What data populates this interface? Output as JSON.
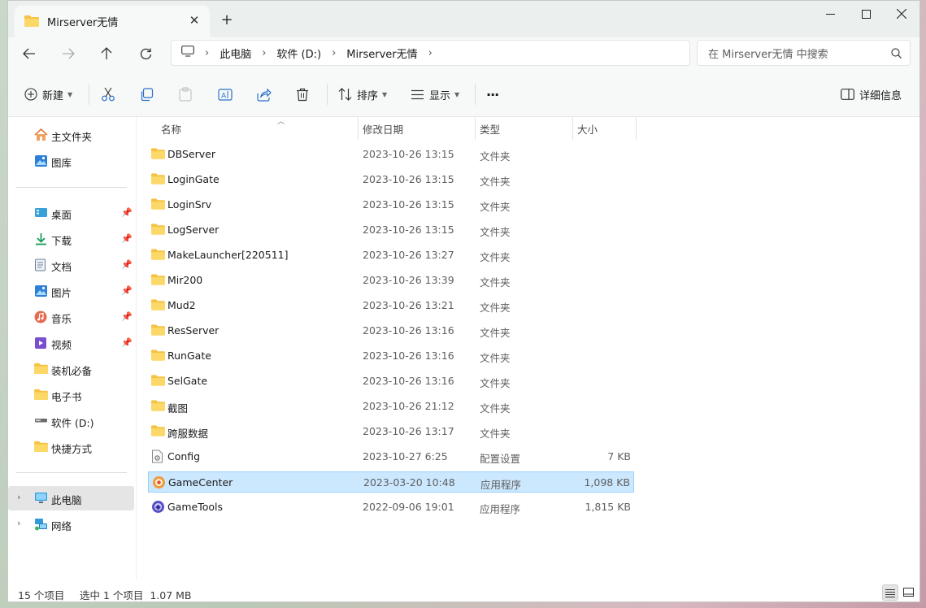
{
  "window": {
    "tab_title": "Mirserver无情",
    "new_tab_symbol": "+"
  },
  "address": {
    "crumbs": [
      "此电脑",
      "软件 (D:)",
      "Mirserver无情"
    ],
    "search_placeholder": "在 Mirserver无情 中搜索"
  },
  "toolbar": {
    "new_label": "新建",
    "sort_label": "排序",
    "view_label": "显示",
    "more_label": "···",
    "details_label": "详细信息"
  },
  "sidebar": {
    "top": [
      {
        "label": "主文件夹",
        "icon": "home-icon"
      },
      {
        "label": "图库",
        "icon": "gallery-icon"
      }
    ],
    "pinned": [
      {
        "label": "桌面",
        "icon": "desktop-icon"
      },
      {
        "label": "下载",
        "icon": "download-icon"
      },
      {
        "label": "文档",
        "icon": "documents-icon"
      },
      {
        "label": "图片",
        "icon": "pictures-icon"
      },
      {
        "label": "音乐",
        "icon": "music-icon"
      },
      {
        "label": "视频",
        "icon": "videos-icon"
      }
    ],
    "folders": [
      {
        "label": "装机必备",
        "icon": "folder-icon"
      },
      {
        "label": "电子书",
        "icon": "folder-icon"
      },
      {
        "label": "软件 (D:)",
        "icon": "drive-icon"
      },
      {
        "label": "快捷方式",
        "icon": "folder-icon"
      }
    ],
    "bottom": [
      {
        "label": "此电脑",
        "icon": "pc-icon"
      },
      {
        "label": "网络",
        "icon": "network-icon"
      }
    ]
  },
  "columns": {
    "name": "名称",
    "date": "修改日期",
    "type": "类型",
    "size": "大小"
  },
  "files": [
    {
      "name": "DBServer",
      "date": "2023-10-26 13:15",
      "type": "文件夹",
      "size": "",
      "icon": "folder-icon"
    },
    {
      "name": "LoginGate",
      "date": "2023-10-26 13:15",
      "type": "文件夹",
      "size": "",
      "icon": "folder-icon"
    },
    {
      "name": "LoginSrv",
      "date": "2023-10-26 13:15",
      "type": "文件夹",
      "size": "",
      "icon": "folder-icon"
    },
    {
      "name": "LogServer",
      "date": "2023-10-26 13:15",
      "type": "文件夹",
      "size": "",
      "icon": "folder-icon"
    },
    {
      "name": "MakeLauncher[220511]",
      "date": "2023-10-26 13:27",
      "type": "文件夹",
      "size": "",
      "icon": "folder-icon"
    },
    {
      "name": "Mir200",
      "date": "2023-10-26 13:39",
      "type": "文件夹",
      "size": "",
      "icon": "folder-icon"
    },
    {
      "name": "Mud2",
      "date": "2023-10-26 13:21",
      "type": "文件夹",
      "size": "",
      "icon": "folder-icon"
    },
    {
      "name": "ResServer",
      "date": "2023-10-26 13:16",
      "type": "文件夹",
      "size": "",
      "icon": "folder-icon"
    },
    {
      "name": "RunGate",
      "date": "2023-10-26 13:16",
      "type": "文件夹",
      "size": "",
      "icon": "folder-icon"
    },
    {
      "name": "SelGate",
      "date": "2023-10-26 13:16",
      "type": "文件夹",
      "size": "",
      "icon": "folder-icon"
    },
    {
      "name": "截图",
      "date": "2023-10-26 21:12",
      "type": "文件夹",
      "size": "",
      "icon": "folder-icon"
    },
    {
      "name": "跨服数据",
      "date": "2023-10-26 13:17",
      "type": "文件夹",
      "size": "",
      "icon": "folder-icon"
    },
    {
      "name": "Config",
      "date": "2023-10-27 6:25",
      "type": "配置设置",
      "size": "7 KB",
      "icon": "config-file-icon"
    },
    {
      "name": "GameCenter",
      "date": "2023-03-20 10:48",
      "type": "应用程序",
      "size": "1,098 KB",
      "icon": "app-icon",
      "selected": true
    },
    {
      "name": "GameTools",
      "date": "2022-09-06 19:01",
      "type": "应用程序",
      "size": "1,815 KB",
      "icon": "app-icon"
    }
  ],
  "status": {
    "count": "15 个项目",
    "selection": "选中 1 个项目  1.07 MB"
  },
  "colors": {
    "selection_bg": "#cce8ff",
    "folder_yellow": "#f5c243",
    "accent": "#0067c0"
  }
}
